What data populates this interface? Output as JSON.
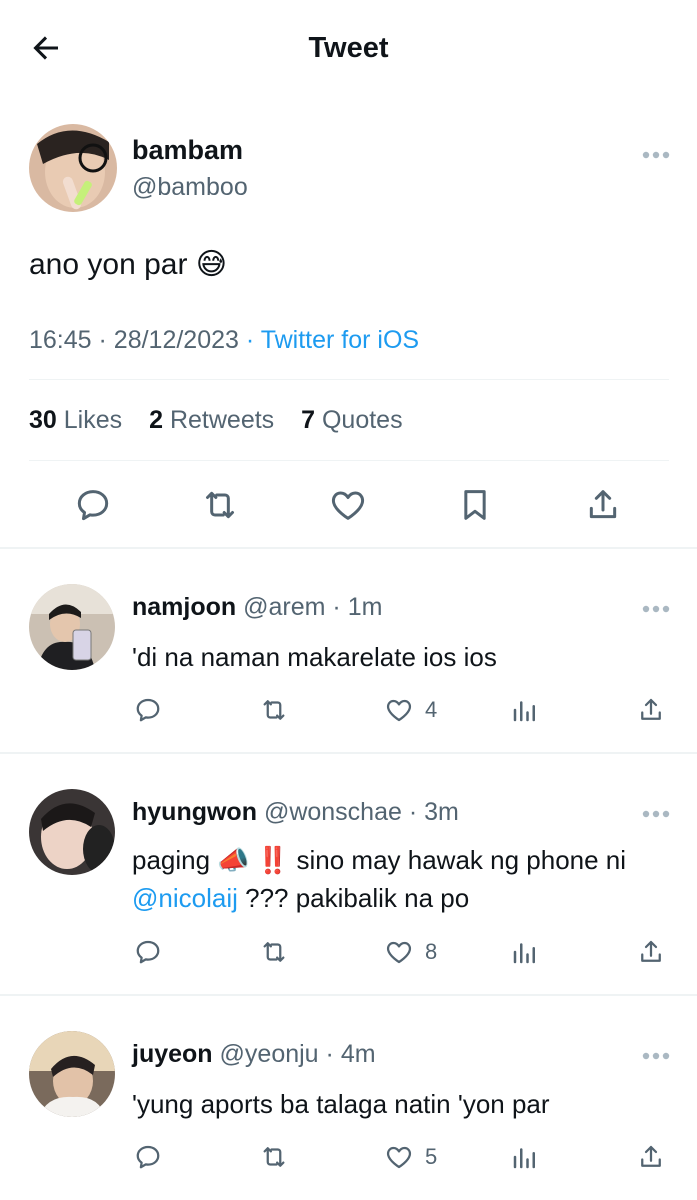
{
  "header": {
    "title": "Tweet"
  },
  "tweet": {
    "display_name": "bambam",
    "handle": "@bamboo",
    "text": "ano yon par 😅",
    "time": "16:45",
    "date": "28/12/2023",
    "source": "Twitter for iOS",
    "stats": {
      "likes_count": "30",
      "likes_label": "Likes",
      "retweets_count": "2",
      "retweets_label": "Retweets",
      "quotes_count": "7",
      "quotes_label": "Quotes"
    }
  },
  "replies": [
    {
      "display_name": "namjoon",
      "handle": "@arem",
      "time": "1m",
      "text": "'di na naman makarelate ios ios",
      "likes": "4"
    },
    {
      "display_name": "hyungwon",
      "handle": "@wonschae",
      "time": "3m",
      "text_before": "paging 📣 ‼️ sino may hawak ng phone ni ",
      "mention": "@nicolaij",
      "text_after": " ??? pakibalik na po",
      "likes": "8"
    },
    {
      "display_name": "juyeon",
      "handle": "@yeonju",
      "time": "4m",
      "text": "'yung aports ba talaga natin 'yon par",
      "likes": "5"
    }
  ],
  "icons": {
    "back": "arrow-left-icon",
    "reply": "comment-icon",
    "retweet": "retweet-icon",
    "like": "heart-icon",
    "bookmark": "bookmark-icon",
    "share": "share-icon",
    "views": "bar-chart-icon",
    "more": "more-dots-icon"
  },
  "colors": {
    "link": "#1d9bf0",
    "secondary": "#536471",
    "text": "#0f1419"
  }
}
